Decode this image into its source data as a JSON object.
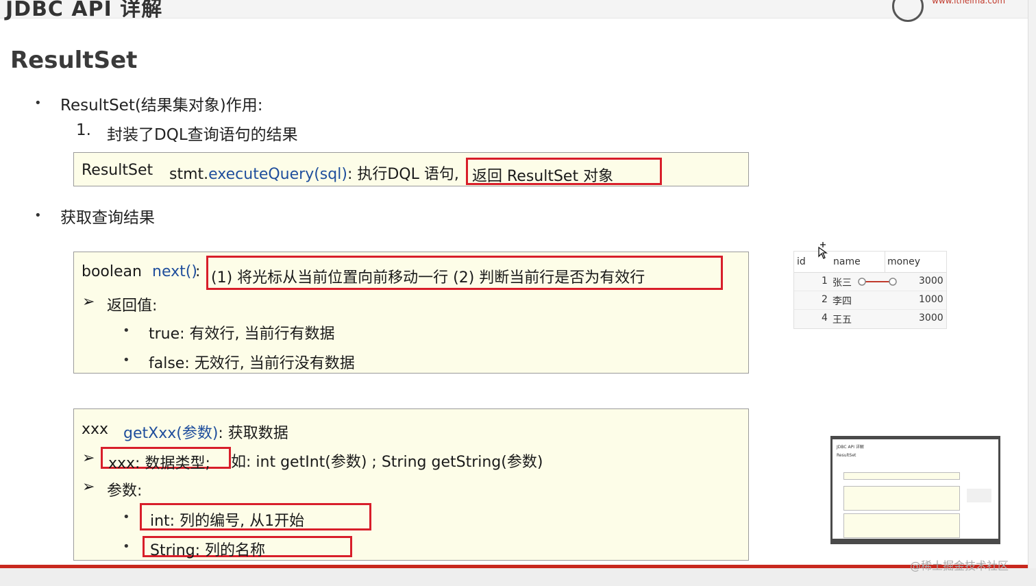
{
  "slide_title": "JDBC API 详解",
  "site_url": "www.itheima.com",
  "heading": "ResultSet",
  "bullet1": "ResultSet(结果集对象)作用:",
  "bullet1_item_num": "1.",
  "bullet1_item": "封装了DQL查询语句的结果",
  "box1": {
    "type_text": "ResultSet",
    "method_obj": "stmt.",
    "method_call": "executeQuery(sql)",
    "desc": ": 执行DQL 语句,",
    "highlight": "返回 ResultSet 对象"
  },
  "bullet2": "获取查询结果",
  "box2": {
    "type_text": "boolean",
    "method": "next()",
    "colon": ":",
    "highlight": "(1) 将光标从当前位置向前移动一行 (2) 判断当前行是否为有效行",
    "arrow_label": "返回值:",
    "sub_items": [
      "true: 有效行, 当前行有数据",
      "false: 无效行, 当前行没有数据"
    ]
  },
  "box3": {
    "type_text": "xxx",
    "method": "getXxx(参数)",
    "desc": ": 获取数据",
    "arrow1_highlight": "xxx: 数据类型;",
    "arrow1_rest": "如: int getInt(参数) ; String getString(参数)",
    "arrow2_label": "参数:",
    "sub_items": [
      "int: 列的编号, 从1开始",
      "String: 列的名称"
    ]
  },
  "table": {
    "headers": [
      "id",
      "name",
      "money"
    ],
    "rows": [
      [
        "1",
        "张三",
        "3000"
      ],
      [
        "2",
        "李四",
        "1000"
      ],
      [
        "4",
        "王五",
        "3000"
      ]
    ]
  },
  "thumbnail": {
    "title": "JDBC API 详解",
    "heading": "ResultSet"
  },
  "watermark": "@稀土掘金技术社区",
  "colors": {
    "box_bg": "#fdfde8",
    "highlight_red": "#d81e2a",
    "method_blue": "#1f4e9c",
    "bottom_bar": "#c8281e"
  }
}
